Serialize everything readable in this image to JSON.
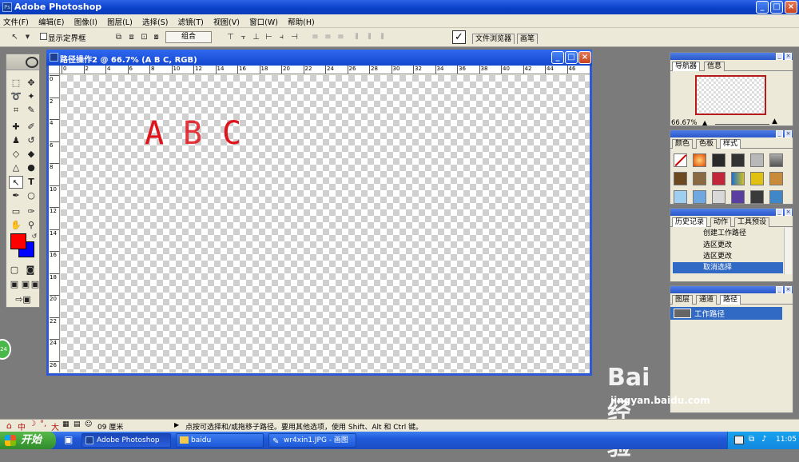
{
  "app": {
    "title": "Adobe Photoshop"
  },
  "menubar": [
    "文件(F)",
    "编辑(E)",
    "图像(I)",
    "图层(L)",
    "选择(S)",
    "滤镜(T)",
    "视图(V)",
    "窗口(W)",
    "帮助(H)"
  ],
  "options": {
    "show_bounding_box": "显示定界框",
    "combine_button": "组合",
    "well_tabs": [
      "文件浏览器",
      "画笔"
    ]
  },
  "document": {
    "title": "路径操作2 @ 66.7% (A B C, RGB)",
    "ruler_top": [
      "0",
      "2",
      "4",
      "6",
      "8",
      "10",
      "12",
      "14",
      "16",
      "18",
      "20",
      "22",
      "24",
      "26",
      "28",
      "30",
      "32",
      "34",
      "36",
      "38",
      "40",
      "42",
      "44",
      "46"
    ],
    "ruler_left": [
      "0",
      "2",
      "4",
      "6",
      "8",
      "10",
      "12",
      "14",
      "16",
      "18",
      "20",
      "22",
      "24",
      "26"
    ],
    "letters": [
      "A",
      "B",
      "C"
    ],
    "letter_color": "#e0131b"
  },
  "panels": {
    "navigator": {
      "tabs": [
        "导航器",
        "信息"
      ],
      "zoom": "66.67%"
    },
    "color": {
      "tabs": [
        "颜色",
        "色板",
        "样式"
      ]
    },
    "history": {
      "tabs": [
        "历史记录",
        "动作",
        "工具预设"
      ],
      "items": [
        "创建工作路径",
        "选区更改",
        "选区更改",
        "取消选择"
      ]
    },
    "layers": {
      "tabs": [
        "图层",
        "通道",
        "路径"
      ],
      "path_item": "工作路径"
    }
  },
  "statusbar": {
    "ime": "中",
    "ime2": "大",
    "size": "09 厘米",
    "hint": "点按可选择和/或拖移子路径。要用其他选项，使用 Shift、Alt 和 Ctrl 键。"
  },
  "taskbar": {
    "start": "开始",
    "tasks": [
      "Adobe Photoshop",
      "baidu",
      "wr4xin1.JPG - 画图"
    ],
    "clock": "11:05"
  },
  "badge": "24",
  "watermark": {
    "brand": "Bai  经验",
    "url": "jingyan.baidu.com"
  },
  "colors": {
    "foreground": "#ff0000",
    "background": "#0000ff",
    "accent": "#2f58d8"
  }
}
